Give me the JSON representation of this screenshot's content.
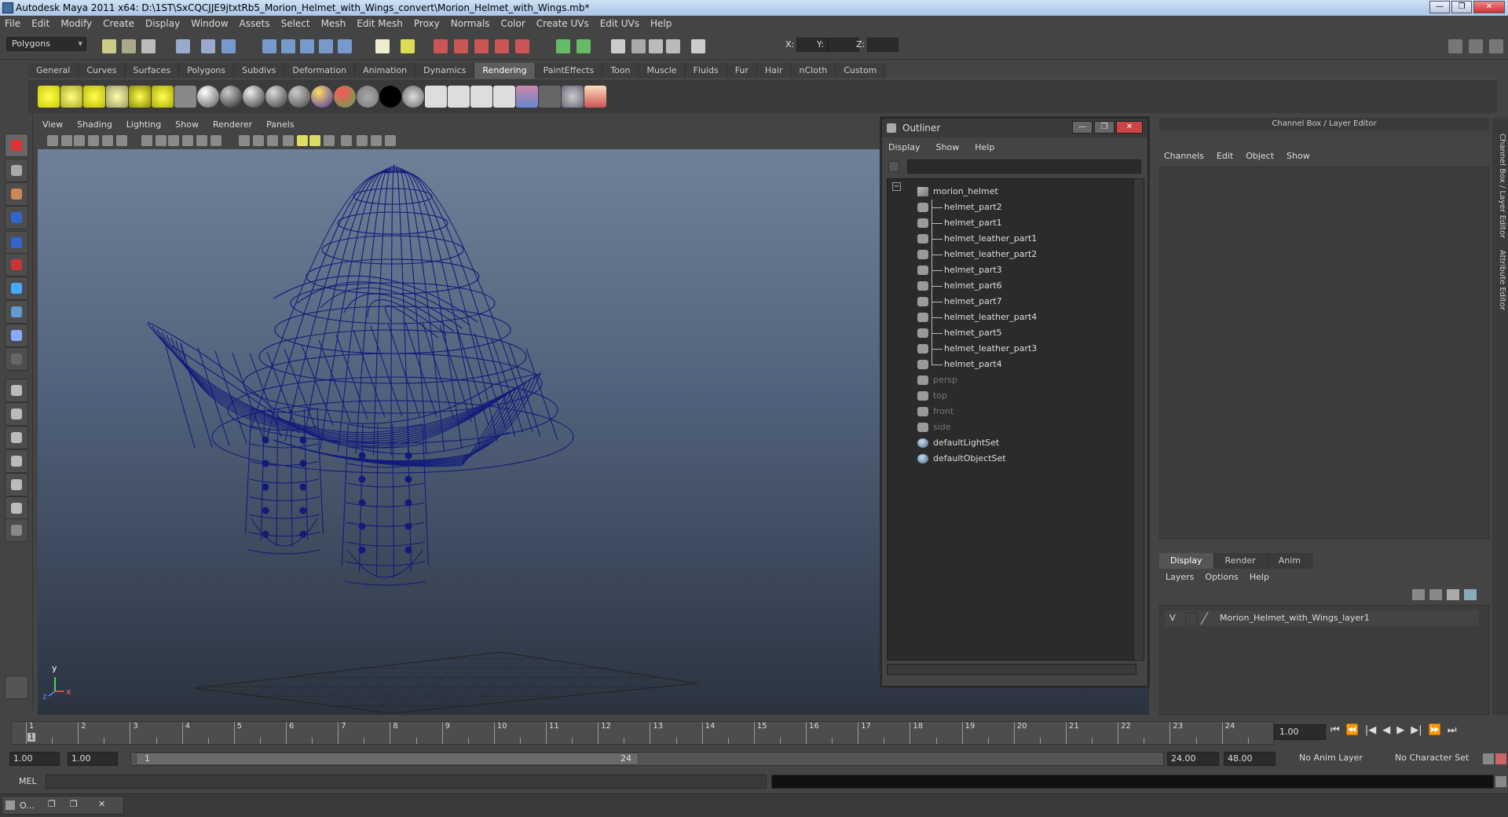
{
  "window": {
    "title": "Autodesk Maya 2011 x64: D:\\1ST\\SxCQCJJE9jtxtRb5_Morion_Helmet_with_Wings_convert\\Morion_Helmet_with_Wings.mb*",
    "minimize": "—",
    "maximize": "❐",
    "close": "✕"
  },
  "menubar": [
    "File",
    "Edit",
    "Modify",
    "Create",
    "Display",
    "Window",
    "Assets",
    "Select",
    "Mesh",
    "Edit Mesh",
    "Proxy",
    "Normals",
    "Color",
    "Create UVs",
    "Edit UVs",
    "Help"
  ],
  "status": {
    "mode": "Polygons",
    "x_label": "X:",
    "y_label": "Y:",
    "z_label": "Z:"
  },
  "shelf": {
    "tabs": [
      "General",
      "Curves",
      "Surfaces",
      "Polygons",
      "Subdivs",
      "Deformation",
      "Animation",
      "Dynamics",
      "Rendering",
      "PaintEffects",
      "Toon",
      "Muscle",
      "Fluids",
      "Fur",
      "Hair",
      "nCloth",
      "Custom"
    ],
    "active_tab": "Rendering"
  },
  "panel": {
    "menu": [
      "View",
      "Shading",
      "Lighting",
      "Show",
      "Renderer",
      "Panels"
    ],
    "axis_y": "y",
    "axis_x": "x",
    "axis_z": "z"
  },
  "outliner": {
    "title": "Outliner",
    "menu": [
      "Display",
      "Show",
      "Help"
    ],
    "collapse_symbol": "−",
    "items": [
      {
        "label": "morion_helmet",
        "kind": "group",
        "level": 0,
        "dim": false
      },
      {
        "label": "helmet_part2",
        "kind": "mesh",
        "level": 1,
        "dim": false
      },
      {
        "label": "helmet_part1",
        "kind": "mesh",
        "level": 1,
        "dim": false
      },
      {
        "label": "helmet_leather_part1",
        "kind": "mesh",
        "level": 1,
        "dim": false
      },
      {
        "label": "helmet_leather_part2",
        "kind": "mesh",
        "level": 1,
        "dim": false
      },
      {
        "label": "helmet_part3",
        "kind": "mesh",
        "level": 1,
        "dim": false
      },
      {
        "label": "helmet_part6",
        "kind": "mesh",
        "level": 1,
        "dim": false
      },
      {
        "label": "helmet_part7",
        "kind": "mesh",
        "level": 1,
        "dim": false
      },
      {
        "label": "helmet_leather_part4",
        "kind": "mesh",
        "level": 1,
        "dim": false
      },
      {
        "label": "helmet_part5",
        "kind": "mesh",
        "level": 1,
        "dim": false
      },
      {
        "label": "helmet_leather_part3",
        "kind": "mesh",
        "level": 1,
        "dim": false
      },
      {
        "label": "helmet_part4",
        "kind": "mesh",
        "level": 1,
        "dim": false
      },
      {
        "label": "persp",
        "kind": "camera",
        "level": 0,
        "dim": true
      },
      {
        "label": "top",
        "kind": "camera",
        "level": 0,
        "dim": true
      },
      {
        "label": "front",
        "kind": "camera",
        "level": 0,
        "dim": true
      },
      {
        "label": "side",
        "kind": "camera",
        "level": 0,
        "dim": true
      },
      {
        "label": "defaultLightSet",
        "kind": "set",
        "level": 0,
        "dim": false
      },
      {
        "label": "defaultObjectSet",
        "kind": "set",
        "level": 0,
        "dim": false
      }
    ]
  },
  "channel_box": {
    "header": "Channel Box / Layer Editor",
    "menu": [
      "Channels",
      "Edit",
      "Object",
      "Show"
    ],
    "layer_tabs": [
      "Display",
      "Render",
      "Anim"
    ],
    "active_layer_tab": "Display",
    "layer_menu": [
      "Layers",
      "Options",
      "Help"
    ],
    "layer": {
      "visible": "V",
      "name": "Morion_Helmet_with_Wings_layer1"
    }
  },
  "side_tabs": [
    "Channel Box / Layer Editor",
    "Attribute Editor"
  ],
  "timeline": {
    "ticks": [
      "1",
      "2",
      "3",
      "4",
      "5",
      "6",
      "7",
      "8",
      "9",
      "10",
      "11",
      "12",
      "13",
      "14",
      "15",
      "16",
      "17",
      "18",
      "19",
      "20",
      "21",
      "22",
      "23",
      "24"
    ],
    "current_marker": "1",
    "current_frame": "1.00",
    "play_controls": [
      "⏮",
      "⏪",
      "|◀",
      "◀",
      "▶",
      "▶|",
      "⏩",
      "⏭"
    ]
  },
  "range": {
    "start": "1.00",
    "anim_start": "1.00",
    "range_start_label": "1",
    "range_end_label": "24",
    "end": "24.00",
    "anim_end": "48.00",
    "anim_layer": "No Anim Layer",
    "character_set": "No Character Set"
  },
  "command": {
    "label": "MEL"
  },
  "taskbar": {
    "item": "O..."
  },
  "colors": {
    "wire": "#141a7a",
    "viewport_top": "#6f8199",
    "viewport_bottom": "#2b333f",
    "active_shelf_tab": "#5d5d5d"
  }
}
